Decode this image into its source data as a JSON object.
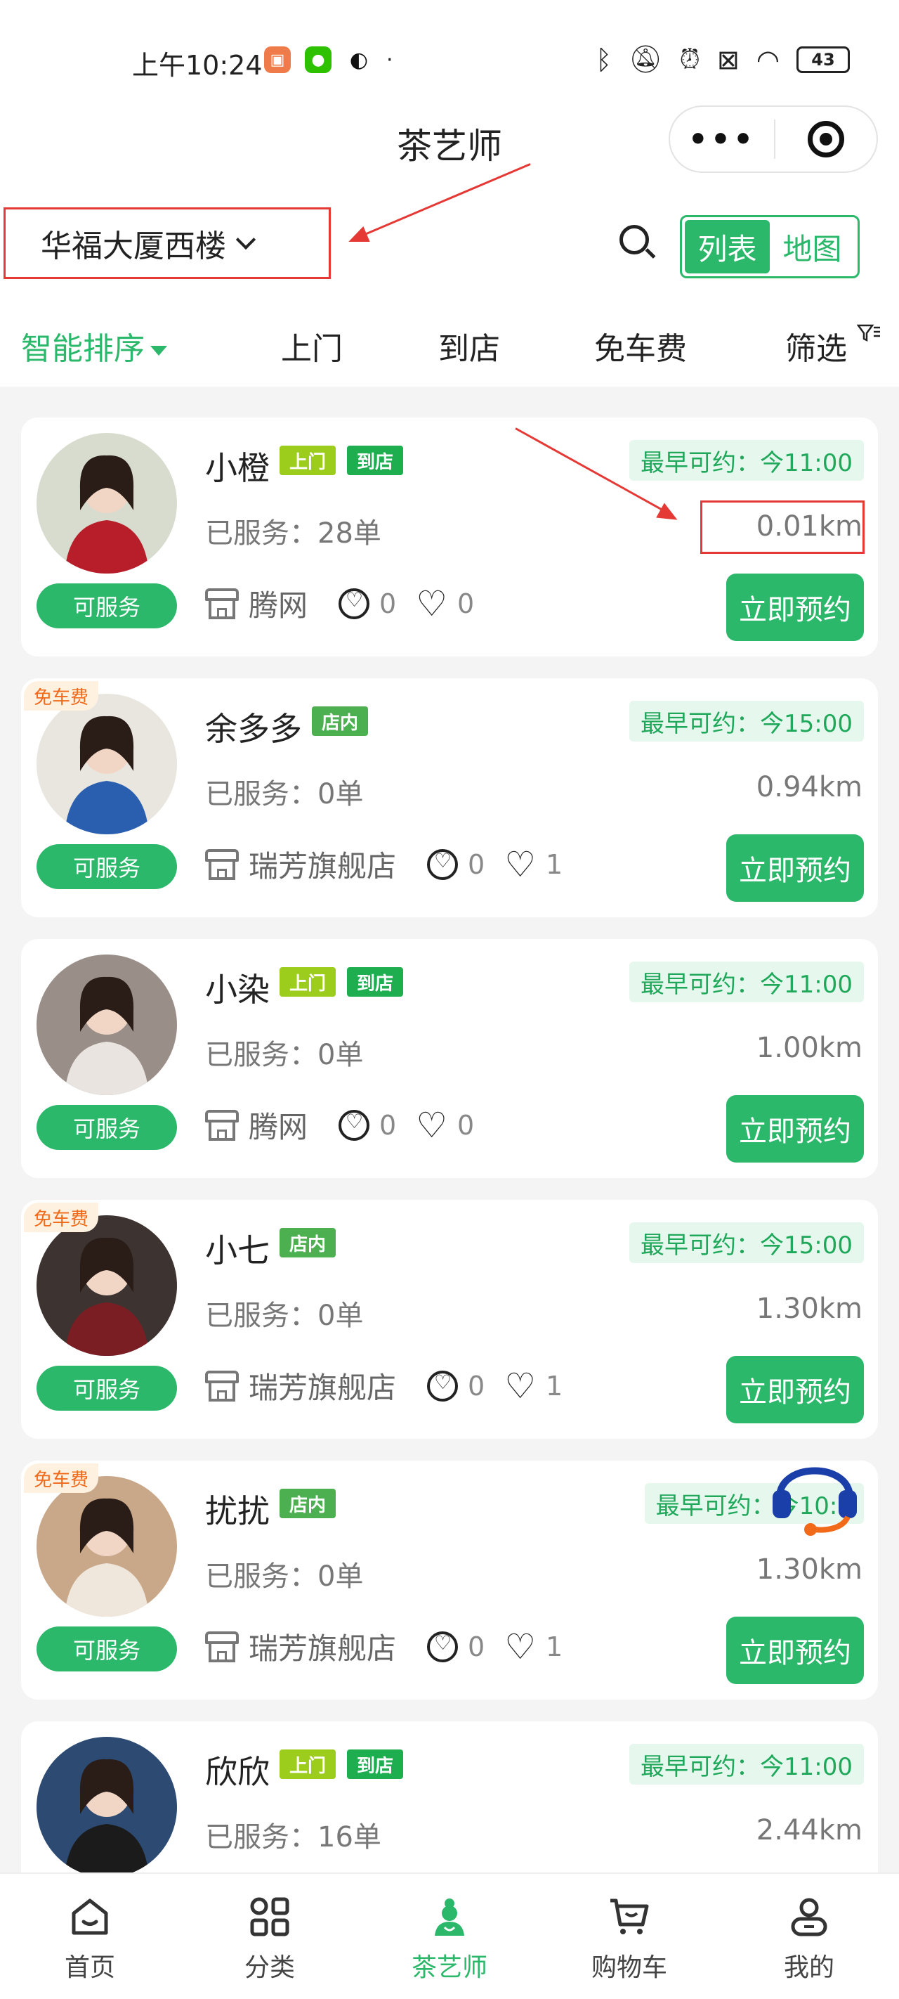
{
  "status_bar": {
    "time": "上午10:24",
    "battery": "43"
  },
  "header": {
    "title": "茶艺师"
  },
  "location": {
    "name": "华福大厦西楼"
  },
  "view_toggle": {
    "list_label": "列表",
    "map_label": "地图"
  },
  "filters": {
    "tabs": [
      "智能排序",
      "上门",
      "到店",
      "免车费",
      "筛选"
    ]
  },
  "labels": {
    "earliest_prefix": "最早可约：",
    "served_prefix": "已服务：",
    "available": "可服务",
    "book": "立即预约"
  },
  "therapists": [
    {
      "name": "小橙",
      "tags": [
        "上门",
        "到店"
      ],
      "earliest": "最早可约：今11:00",
      "served": "已服务：28单",
      "distance": "0.01km",
      "shop": "腾网",
      "count_a": "0",
      "likes": "0",
      "free_fare": "",
      "status": "可服务",
      "button": "立即预约"
    },
    {
      "name": "余多多",
      "tags": [
        "店内"
      ],
      "earliest": "最早可约：今15:00",
      "served": "已服务：0单",
      "distance": "0.94km",
      "shop": "瑞芳旗舰店",
      "count_a": "0",
      "likes": "1",
      "free_fare": "免车费",
      "status": "可服务",
      "button": "立即预约"
    },
    {
      "name": "小染",
      "tags": [
        "上门",
        "到店"
      ],
      "earliest": "最早可约：今11:00",
      "served": "已服务：0单",
      "distance": "1.00km",
      "shop": "腾网",
      "count_a": "0",
      "likes": "0",
      "free_fare": "",
      "status": "可服务",
      "button": "立即预约"
    },
    {
      "name": "小七",
      "tags": [
        "店内"
      ],
      "earliest": "最早可约：今15:00",
      "served": "已服务：0单",
      "distance": "1.30km",
      "shop": "瑞芳旗舰店",
      "count_a": "0",
      "likes": "1",
      "free_fare": "免车费",
      "status": "可服务",
      "button": "立即预约"
    },
    {
      "name": "扰扰",
      "tags": [
        "店内"
      ],
      "earliest": "最早可约：今10:3",
      "served": "已服务：0单",
      "distance": "1.30km",
      "shop": "瑞芳旗舰店",
      "count_a": "0",
      "likes": "1",
      "free_fare": "免车费",
      "status": "可服务",
      "button": "立即预约"
    },
    {
      "name": "欣欣",
      "tags": [
        "上门",
        "到店"
      ],
      "earliest": "最早可约：今11:00",
      "served": "已服务：16单",
      "distance": "2.44km",
      "shop": "",
      "count_a": "",
      "likes": "",
      "free_fare": "",
      "status": "",
      "button": ""
    }
  ],
  "bottom_nav": [
    {
      "label": "首页",
      "icon": "home-icon"
    },
    {
      "label": "分类",
      "icon": "category-icon"
    },
    {
      "label": "茶艺师",
      "icon": "tea-artist-icon"
    },
    {
      "label": "购物车",
      "icon": "cart-icon"
    },
    {
      "label": "我的",
      "icon": "profile-icon"
    }
  ],
  "colors": {
    "brand_green": "#2bb86b",
    "annotation_red": "#e53935"
  }
}
